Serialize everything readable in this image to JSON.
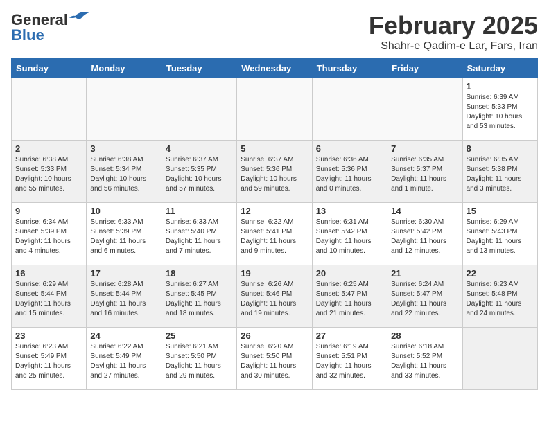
{
  "logo": {
    "line1": "General",
    "line2": "Blue"
  },
  "header": {
    "month": "February 2025",
    "location": "Shahr-e Qadim-e Lar, Fars, Iran"
  },
  "days_of_week": [
    "Sunday",
    "Monday",
    "Tuesday",
    "Wednesday",
    "Thursday",
    "Friday",
    "Saturday"
  ],
  "weeks": [
    [
      {
        "day": "",
        "info": ""
      },
      {
        "day": "",
        "info": ""
      },
      {
        "day": "",
        "info": ""
      },
      {
        "day": "",
        "info": ""
      },
      {
        "day": "",
        "info": ""
      },
      {
        "day": "",
        "info": ""
      },
      {
        "day": "1",
        "info": "Sunrise: 6:39 AM\nSunset: 5:33 PM\nDaylight: 10 hours\nand 53 minutes."
      }
    ],
    [
      {
        "day": "2",
        "info": "Sunrise: 6:38 AM\nSunset: 5:33 PM\nDaylight: 10 hours\nand 55 minutes."
      },
      {
        "day": "3",
        "info": "Sunrise: 6:38 AM\nSunset: 5:34 PM\nDaylight: 10 hours\nand 56 minutes."
      },
      {
        "day": "4",
        "info": "Sunrise: 6:37 AM\nSunset: 5:35 PM\nDaylight: 10 hours\nand 57 minutes."
      },
      {
        "day": "5",
        "info": "Sunrise: 6:37 AM\nSunset: 5:36 PM\nDaylight: 10 hours\nand 59 minutes."
      },
      {
        "day": "6",
        "info": "Sunrise: 6:36 AM\nSunset: 5:36 PM\nDaylight: 11 hours\nand 0 minutes."
      },
      {
        "day": "7",
        "info": "Sunrise: 6:35 AM\nSunset: 5:37 PM\nDaylight: 11 hours\nand 1 minute."
      },
      {
        "day": "8",
        "info": "Sunrise: 6:35 AM\nSunset: 5:38 PM\nDaylight: 11 hours\nand 3 minutes."
      }
    ],
    [
      {
        "day": "9",
        "info": "Sunrise: 6:34 AM\nSunset: 5:39 PM\nDaylight: 11 hours\nand 4 minutes."
      },
      {
        "day": "10",
        "info": "Sunrise: 6:33 AM\nSunset: 5:39 PM\nDaylight: 11 hours\nand 6 minutes."
      },
      {
        "day": "11",
        "info": "Sunrise: 6:33 AM\nSunset: 5:40 PM\nDaylight: 11 hours\nand 7 minutes."
      },
      {
        "day": "12",
        "info": "Sunrise: 6:32 AM\nSunset: 5:41 PM\nDaylight: 11 hours\nand 9 minutes."
      },
      {
        "day": "13",
        "info": "Sunrise: 6:31 AM\nSunset: 5:42 PM\nDaylight: 11 hours\nand 10 minutes."
      },
      {
        "day": "14",
        "info": "Sunrise: 6:30 AM\nSunset: 5:42 PM\nDaylight: 11 hours\nand 12 minutes."
      },
      {
        "day": "15",
        "info": "Sunrise: 6:29 AM\nSunset: 5:43 PM\nDaylight: 11 hours\nand 13 minutes."
      }
    ],
    [
      {
        "day": "16",
        "info": "Sunrise: 6:29 AM\nSunset: 5:44 PM\nDaylight: 11 hours\nand 15 minutes."
      },
      {
        "day": "17",
        "info": "Sunrise: 6:28 AM\nSunset: 5:44 PM\nDaylight: 11 hours\nand 16 minutes."
      },
      {
        "day": "18",
        "info": "Sunrise: 6:27 AM\nSunset: 5:45 PM\nDaylight: 11 hours\nand 18 minutes."
      },
      {
        "day": "19",
        "info": "Sunrise: 6:26 AM\nSunset: 5:46 PM\nDaylight: 11 hours\nand 19 minutes."
      },
      {
        "day": "20",
        "info": "Sunrise: 6:25 AM\nSunset: 5:47 PM\nDaylight: 11 hours\nand 21 minutes."
      },
      {
        "day": "21",
        "info": "Sunrise: 6:24 AM\nSunset: 5:47 PM\nDaylight: 11 hours\nand 22 minutes."
      },
      {
        "day": "22",
        "info": "Sunrise: 6:23 AM\nSunset: 5:48 PM\nDaylight: 11 hours\nand 24 minutes."
      }
    ],
    [
      {
        "day": "23",
        "info": "Sunrise: 6:23 AM\nSunset: 5:49 PM\nDaylight: 11 hours\nand 25 minutes."
      },
      {
        "day": "24",
        "info": "Sunrise: 6:22 AM\nSunset: 5:49 PM\nDaylight: 11 hours\nand 27 minutes."
      },
      {
        "day": "25",
        "info": "Sunrise: 6:21 AM\nSunset: 5:50 PM\nDaylight: 11 hours\nand 29 minutes."
      },
      {
        "day": "26",
        "info": "Sunrise: 6:20 AM\nSunset: 5:50 PM\nDaylight: 11 hours\nand 30 minutes."
      },
      {
        "day": "27",
        "info": "Sunrise: 6:19 AM\nSunset: 5:51 PM\nDaylight: 11 hours\nand 32 minutes."
      },
      {
        "day": "28",
        "info": "Sunrise: 6:18 AM\nSunset: 5:52 PM\nDaylight: 11 hours\nand 33 minutes."
      },
      {
        "day": "",
        "info": ""
      }
    ]
  ]
}
